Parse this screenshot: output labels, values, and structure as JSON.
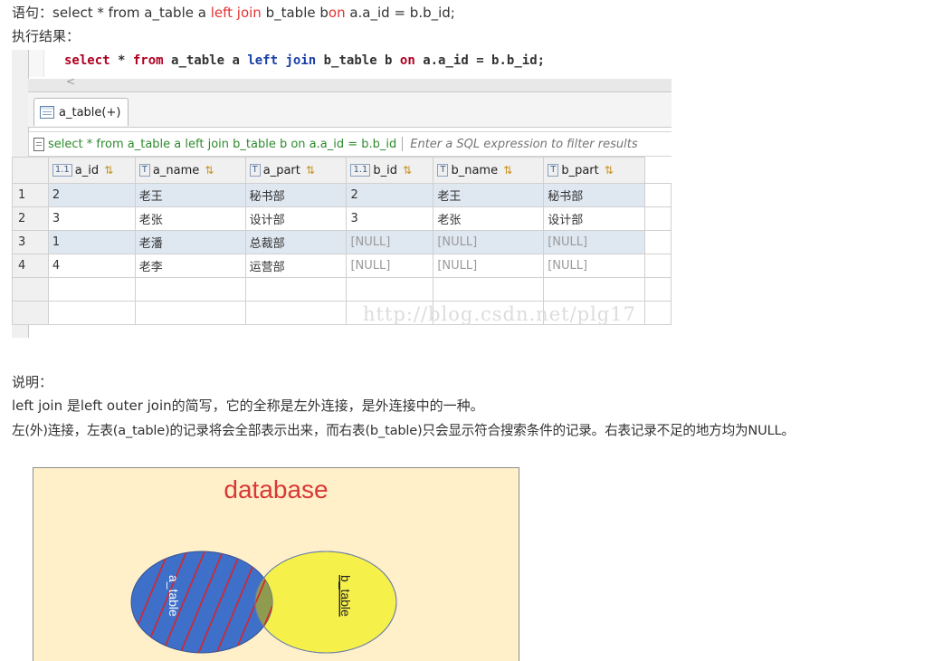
{
  "intro": {
    "statement_label": "语句：",
    "statement_pre": "select * from a_table a ",
    "statement_kw1": "left join",
    "statement_mid": " b_table b",
    "statement_kw2": "on",
    "statement_post": " a.a_id = b.b_id;",
    "result_label": "执行结果："
  },
  "editor": {
    "kw_select": "select",
    "star": " * ",
    "kw_from": "from",
    "table_a": " a_table a ",
    "kw_left": "left",
    "kw_join": " join",
    "table_b": " b_table b ",
    "kw_on": "on",
    "condition": " a.a_id = b.b_id;",
    "scroll_glyph": "<"
  },
  "tab": {
    "label": "a_table(+)"
  },
  "filter": {
    "query": "select * from a_table a left join b_table b on a.a_id = b.b_id",
    "placeholder": "Enter a SQL expression to filter results"
  },
  "grid": {
    "columns": [
      {
        "label": "a_id",
        "type_icon": "1.1"
      },
      {
        "label": "a_name",
        "type_icon": "T"
      },
      {
        "label": "a_part",
        "type_icon": "T"
      },
      {
        "label": "b_id",
        "type_icon": "1.1"
      },
      {
        "label": "b_name",
        "type_icon": "T"
      },
      {
        "label": "b_part",
        "type_icon": "T"
      }
    ],
    "rows": [
      {
        "n": "1",
        "cells": [
          "2",
          "老王",
          "秘书部",
          "2",
          "老王",
          "秘书部"
        ]
      },
      {
        "n": "2",
        "cells": [
          "3",
          "老张",
          "设计部",
          "3",
          "老张",
          "设计部"
        ]
      },
      {
        "n": "3",
        "cells": [
          "1",
          "老潘",
          "总裁部",
          "[NULL]",
          "[NULL]",
          "[NULL]"
        ]
      },
      {
        "n": "4",
        "cells": [
          "4",
          "老李",
          "运营部",
          "[NULL]",
          "[NULL]",
          "[NULL]"
        ]
      }
    ],
    "watermark": "http://blog.csdn.net/plg17"
  },
  "explain": {
    "heading": "说明：",
    "line1": "left join 是left outer join的简写，它的全称是左外连接，是外连接中的一种。",
    "line2": "左(外)连接，左表(a_table)的记录将会全部表示出来，而右表(b_table)只会显示符合搜索条件的记录。右表记录不足的地方均为NULL。"
  },
  "diagram": {
    "title": "database",
    "left_label": "a_table",
    "right_label": "b_table",
    "colors": {
      "background": "#fff0c9",
      "left": "#3e6fc9",
      "right": "#f5f04a",
      "overlap": "#8f9b4e",
      "hatch": "#d6262a",
      "title": "#d93838"
    }
  }
}
